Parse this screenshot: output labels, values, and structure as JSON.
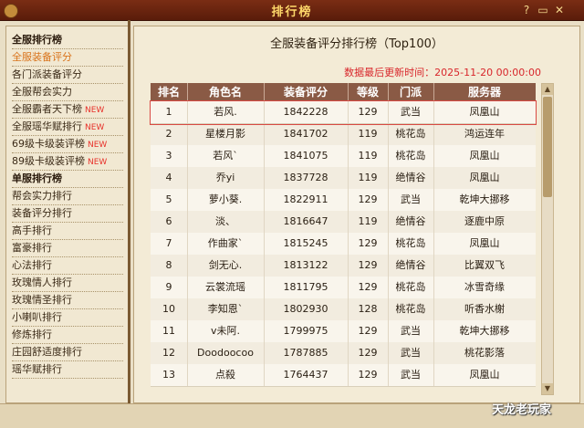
{
  "window": {
    "title": "排行榜"
  },
  "sidebar": {
    "items": [
      {
        "label": "全服排行榜",
        "type": "header"
      },
      {
        "label": "全服装备评分",
        "type": "active"
      },
      {
        "label": "各门派装备评分",
        "type": "item"
      },
      {
        "label": "全服帮会实力",
        "type": "item"
      },
      {
        "label": "全服霸者天下榜",
        "type": "item",
        "badge": "NEW"
      },
      {
        "label": "全服瑶华赋排行",
        "type": "item",
        "badge": "NEW"
      },
      {
        "label": "69级卡级装评榜",
        "type": "item",
        "badge": "NEW"
      },
      {
        "label": "89级卡级装评榜",
        "type": "item",
        "badge": "NEW"
      },
      {
        "label": "单服排行榜",
        "type": "header"
      },
      {
        "label": "帮会实力排行",
        "type": "item"
      },
      {
        "label": "装备评分排行",
        "type": "item"
      },
      {
        "label": "高手排行",
        "type": "item"
      },
      {
        "label": "富豪排行",
        "type": "item"
      },
      {
        "label": "心法排行",
        "type": "item"
      },
      {
        "label": "玫瑰情人排行",
        "type": "item"
      },
      {
        "label": "玫瑰情圣排行",
        "type": "item"
      },
      {
        "label": "小喇叭排行",
        "type": "item"
      },
      {
        "label": "修炼排行",
        "type": "item"
      },
      {
        "label": "庄园舒适度排行",
        "type": "item"
      },
      {
        "label": "瑶华赋排行",
        "type": "item"
      }
    ]
  },
  "main": {
    "title": "全服装备评分排行榜（Top100）",
    "update_time": "数据最后更新时间：2025-11-20 00:00:00"
  },
  "table": {
    "headers": [
      "排名",
      "角色名",
      "装备评分",
      "等级",
      "门派",
      "服务器"
    ],
    "rows": [
      [
        "1",
        "若风.",
        "1842228",
        "129",
        "武当",
        "凤凰山"
      ],
      [
        "2",
        "星楼月影",
        "1841702",
        "119",
        "桃花岛",
        "鸿运连年"
      ],
      [
        "3",
        "若风`",
        "1841075",
        "119",
        "桃花岛",
        "凤凰山"
      ],
      [
        "4",
        "乔yi",
        "1837728",
        "119",
        "绝情谷",
        "凤凰山"
      ],
      [
        "5",
        "萝小葵.",
        "1822911",
        "129",
        "武当",
        "乾坤大挪移"
      ],
      [
        "6",
        "淡、",
        "1816647",
        "119",
        "绝情谷",
        "逐鹿中原"
      ],
      [
        "7",
        "作曲家`",
        "1815245",
        "129",
        "桃花岛",
        "凤凰山"
      ],
      [
        "8",
        "剑无心.",
        "1813122",
        "129",
        "绝情谷",
        "比翼双飞"
      ],
      [
        "9",
        "云裳流瑶",
        "1811795",
        "129",
        "桃花岛",
        "冰雪奇缘"
      ],
      [
        "10",
        "李知恩`",
        "1802930",
        "128",
        "桃花岛",
        "听香水榭"
      ],
      [
        "11",
        "v未阿.",
        "1799975",
        "129",
        "武当",
        "乾坤大挪移"
      ],
      [
        "12",
        "Doodoocoo",
        "1787885",
        "129",
        "武当",
        "桃花影落"
      ],
      [
        "13",
        "点殺",
        "1764437",
        "129",
        "武当",
        "凤凰山"
      ]
    ],
    "selected_row": 0
  },
  "watermark": "天龙老玩家",
  "colors": {
    "accent": "#d9731b",
    "new_badge": "#e8322b",
    "update_time": "#d8262b",
    "header_bg": "#8a5a45"
  }
}
